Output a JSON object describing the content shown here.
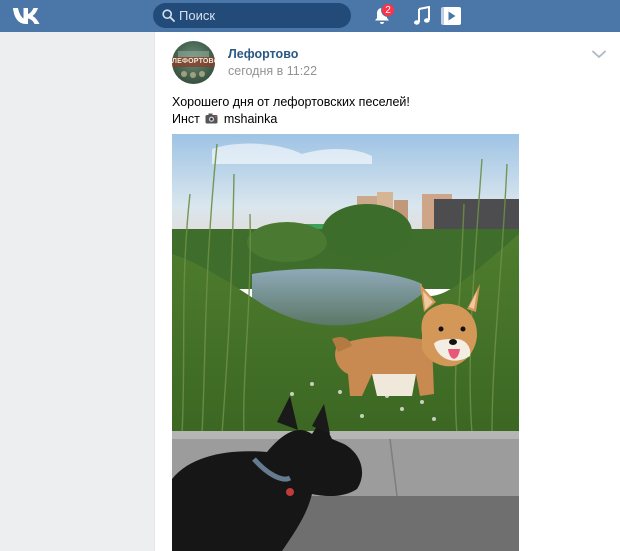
{
  "header": {
    "search_placeholder": "Поиск",
    "notifications_count": "2",
    "colors": {
      "bar": "#4a76a8",
      "search_bg": "#224b7a",
      "badge": "#ff3347"
    },
    "icons": [
      "vk-logo-icon",
      "search-icon",
      "bell-icon",
      "music-icon",
      "video-icon"
    ]
  },
  "post": {
    "author": "Лефортово",
    "avatar_text": "ЛЕФОРТОВО",
    "time": "сегодня в 11:22",
    "text_line1": "Хорошего дня от лефортовских песелей!",
    "text_prefix": "Инст",
    "text_username": "mshainka",
    "link_color": "#2a5885",
    "photo_subject": "corgi-and-scottish-terrier-by-pond"
  }
}
